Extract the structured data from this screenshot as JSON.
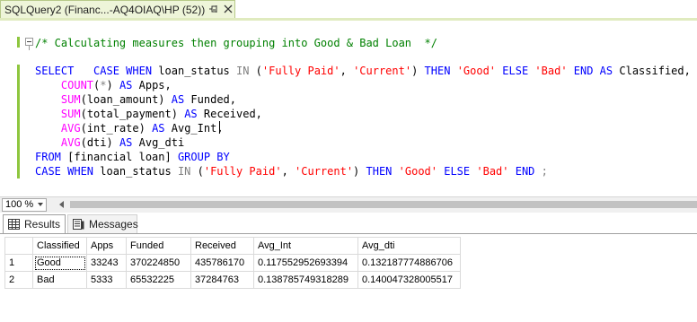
{
  "document_tab": {
    "title": "SQLQuery2 (Financ...-AQ4OIAQ\\HP (52))"
  },
  "editor": {
    "lines": [
      [
        {
          "t": "/* Calculating measures then grouping into Good & Bad Loan  */",
          "c": "cm"
        }
      ],
      [],
      [
        {
          "t": "SELECT",
          "c": "kw"
        },
        {
          "t": "   "
        },
        {
          "t": "CASE WHEN",
          "c": "kw"
        },
        {
          "t": " loan_status "
        },
        {
          "t": "IN",
          "c": "op"
        },
        {
          "t": " ("
        },
        {
          "t": "'Fully Paid'",
          "c": "str"
        },
        {
          "t": ", "
        },
        {
          "t": "'Current'",
          "c": "str"
        },
        {
          "t": ") "
        },
        {
          "t": "THEN",
          "c": "kw"
        },
        {
          "t": " "
        },
        {
          "t": "'Good'",
          "c": "str"
        },
        {
          "t": " "
        },
        {
          "t": "ELSE",
          "c": "kw"
        },
        {
          "t": " "
        },
        {
          "t": "'Bad'",
          "c": "str"
        },
        {
          "t": " "
        },
        {
          "t": "END AS",
          "c": "kw"
        },
        {
          "t": " Classified,"
        }
      ],
      [
        {
          "t": "    "
        },
        {
          "t": "COUNT",
          "c": "fn"
        },
        {
          "t": "("
        },
        {
          "t": "*",
          "c": "op"
        },
        {
          "t": ") "
        },
        {
          "t": "AS",
          "c": "kw"
        },
        {
          "t": " Apps,"
        }
      ],
      [
        {
          "t": "    "
        },
        {
          "t": "SUM",
          "c": "fn"
        },
        {
          "t": "(loan_amount) "
        },
        {
          "t": "AS",
          "c": "kw"
        },
        {
          "t": " Funded,"
        }
      ],
      [
        {
          "t": "    "
        },
        {
          "t": "SUM",
          "c": "fn"
        },
        {
          "t": "(total_payment) "
        },
        {
          "t": "AS",
          "c": "kw"
        },
        {
          "t": " Received,"
        }
      ],
      [
        {
          "t": "    "
        },
        {
          "t": "AVG",
          "c": "fn"
        },
        {
          "t": "(int_rate) "
        },
        {
          "t": "AS",
          "c": "kw"
        },
        {
          "t": " Avg_Int,"
        }
      ],
      [
        {
          "t": "    "
        },
        {
          "t": "AVG",
          "c": "fn"
        },
        {
          "t": "(dti) "
        },
        {
          "t": "AS",
          "c": "kw"
        },
        {
          "t": " Avg_dti"
        }
      ],
      [
        {
          "t": "FROM",
          "c": "kw"
        },
        {
          "t": " [financial loan] "
        },
        {
          "t": "GROUP BY",
          "c": "kw"
        }
      ],
      [
        {
          "t": "CASE WHEN",
          "c": "kw"
        },
        {
          "t": " loan_status "
        },
        {
          "t": "IN",
          "c": "op"
        },
        {
          "t": " ("
        },
        {
          "t": "'Fully Paid'",
          "c": "str"
        },
        {
          "t": ", "
        },
        {
          "t": "'Current'",
          "c": "str"
        },
        {
          "t": ") "
        },
        {
          "t": "THEN",
          "c": "kw"
        },
        {
          "t": " "
        },
        {
          "t": "'Good'",
          "c": "str"
        },
        {
          "t": " "
        },
        {
          "t": "ELSE",
          "c": "kw"
        },
        {
          "t": " "
        },
        {
          "t": "'Bad'",
          "c": "str"
        },
        {
          "t": " "
        },
        {
          "t": "END",
          "c": "kw"
        },
        {
          "t": " "
        },
        {
          "t": ";",
          "c": "op"
        }
      ]
    ]
  },
  "zoom": {
    "value": "100 %"
  },
  "results_tabs": {
    "results_label": "Results",
    "messages_label": "Messages"
  },
  "grid": {
    "columns": [
      "Classified",
      "Apps",
      "Funded",
      "Received",
      "Avg_Int",
      "Avg_dti"
    ],
    "rows": [
      {
        "num": "1",
        "cells": [
          "Good",
          "33243",
          "370224850",
          "435786170",
          "0.117552952693394",
          "0.132187774886706"
        ]
      },
      {
        "num": "2",
        "cells": [
          "Bad",
          "5333",
          "65532225",
          "37284763",
          "0.138785749318289",
          "0.140047328005517"
        ]
      }
    ]
  },
  "colors": {
    "keyword": "#0000ff",
    "function": "#ff00ff",
    "string": "#ff0000",
    "operator": "#808080",
    "comment": "#008000",
    "tab_active_bg": "#eef5d9"
  },
  "icons": [
    "pin-icon",
    "close-icon",
    "collapse-icon",
    "grid-icon",
    "messages-icon"
  ]
}
